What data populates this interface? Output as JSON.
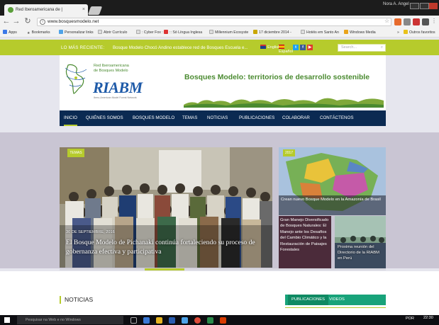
{
  "browser": {
    "tab_title": "Red Iberoamericana de |",
    "tab_close": "×",
    "profile_name": "Nora A. Angel",
    "url": "www.bosquesmodelo.net",
    "bookmarks": [
      "Apps",
      "Bookmarks",
      "Personalizar links",
      "Abrir Currículo",
      ": Cyber Fox :",
      ":: Só Língua Inglesa",
      "Millennium Ecosyste",
      "17 diciembre 2014 -",
      "Hotéis em Santo An",
      "Windows Media",
      "»",
      "Outros favoritos"
    ]
  },
  "site": {
    "topbar": {
      "latest_label": "LO MÁS RECIENTE:",
      "latest_news": "Bosque Modelo Chocó Andino establece red de Bosques Escuela e...",
      "lang_en": "English",
      "lang_es": "Español",
      "search_placeholder": "Search..."
    },
    "header": {
      "org_line1": "Red Iberoamericana",
      "org_line2": "de Bosques Modelo",
      "brand": "RIABM",
      "brand_sub": "Ibero-American Model Forest Network",
      "tagline": "Bosques Modelo: territorios de desarrollo sostenible"
    },
    "nav": [
      "INICIO",
      "QUIÉNES SOMOS",
      "BOSQUES MODELO",
      "TEMAS",
      "NOTICIAS",
      "PUBLICACIONES",
      "COLABORAR",
      "CONTÁCTENOS"
    ],
    "hero": {
      "chip": "TEMAS",
      "date": "30 DE SEPTIEMBRE, 2016",
      "title": "El Bosque Modelo de Pichanaki continúa fortaleciendo su proceso de gobernanza efectiva y participativa",
      "slider_progress": 0.26
    },
    "cards": [
      {
        "badge": "2017",
        "caption": "Crean nuevo Bosque Modelo en la Amazonía de Brasil"
      },
      {
        "caption": "Gran Manejo Diversificado de Bosques Naturales: El Manejo ante los Desafíos del Cambio Climático y la Restauración de Paisajes Forestales"
      },
      {
        "caption": "Proxima reunión del Directorio de la RIABM en Perú"
      }
    ],
    "sections": {
      "news_heading": "NOTICIAS",
      "pub_tab": "PUBLICACIONES",
      "video_tab": "VIDEOS"
    }
  },
  "taskbar": {
    "search_text": "Pesquisar na Web e no Windows",
    "lang": "POR",
    "time": "22:30"
  },
  "colors": {
    "accent_green": "#b6cb2c",
    "nav_navy": "#0b2a52",
    "pub_teal": "#18a37a"
  }
}
